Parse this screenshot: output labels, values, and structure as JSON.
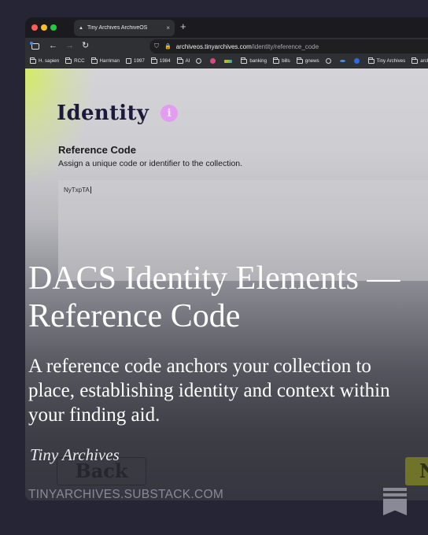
{
  "browser": {
    "tab_title": "Tiny Archives ArchiveOS",
    "tab_close": "×",
    "new_tab": "+",
    "url_host": "archiveos.tinyarchives.com",
    "url_path": "/identity/reference_code",
    "bookmarks": [
      {
        "label": "H. sapien",
        "icon": "folder"
      },
      {
        "label": "RCC",
        "icon": "folder"
      },
      {
        "label": "Harriman",
        "icon": "folder"
      },
      {
        "label": "1997",
        "icon": "calendar"
      },
      {
        "label": "1984",
        "icon": "folder"
      },
      {
        "label": "AI",
        "icon": "folder"
      },
      {
        "label": "",
        "icon": "globe"
      },
      {
        "label": "",
        "icon": "app"
      },
      {
        "label": "",
        "icon": "app"
      },
      {
        "label": "banking",
        "icon": "folder"
      },
      {
        "label": "bills",
        "icon": "folder"
      },
      {
        "label": "gnews",
        "icon": "folder"
      },
      {
        "label": "",
        "icon": "app"
      },
      {
        "label": "",
        "icon": "app"
      },
      {
        "label": "",
        "icon": "app"
      },
      {
        "label": "Tiny Archives",
        "icon": "folder"
      },
      {
        "label": "arch",
        "icon": "folder"
      }
    ]
  },
  "page": {
    "heading": "Identity",
    "info_icon": "i",
    "field_title": "Reference Code",
    "field_description": "Assign a unique code or identifier to the collection.",
    "field_value": "NyTxpTA",
    "back_label": "Back",
    "next_label": "N"
  },
  "overlay": {
    "headline": "DACS Identity Elements — Reference Code",
    "subtext": "A reference code anchors your collection to place, establishing identity and context within your finding aid.",
    "brand": "Tiny Archives",
    "footer_url": "TINYARCHIVES.SUBSTACK.COM"
  },
  "colors": {
    "background": "#262535",
    "accent_glow": "#d2f050",
    "info_icon": "#e39cf0",
    "heading": "#1b1a3a"
  }
}
